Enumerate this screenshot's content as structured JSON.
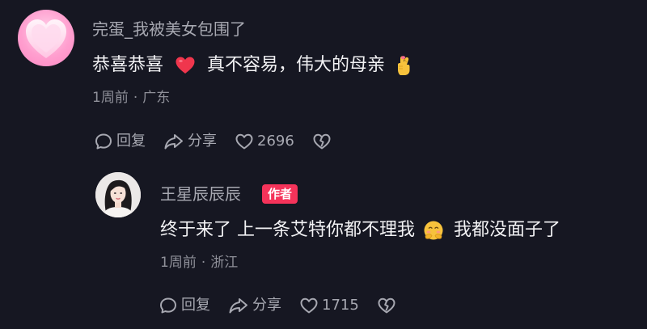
{
  "comment": {
    "username": "完蛋_我被美女包围了",
    "text_part1": "恭喜恭喜",
    "text_part2": "真不容易，伟大的母亲",
    "time": "1周前",
    "separator": "·",
    "location": "广东",
    "actions": {
      "reply_label": "回复",
      "share_label": "分享",
      "like_count": "2696"
    },
    "icons": {
      "avatar": "pink-heart-avatar",
      "emoji_1": "red-heart-emoji",
      "emoji_2": "crossed-fingers-hand-emoji"
    }
  },
  "reply": {
    "username": "王星辰辰辰",
    "badge": "作者",
    "text_part1": "终于来了 上一条艾特你都不理我",
    "text_part2": "我都没面子了",
    "time": "1周前",
    "separator": "·",
    "location": "浙江",
    "actions": {
      "reply_label": "回复",
      "share_label": "分享",
      "like_count": "1715"
    },
    "icons": {
      "avatar": "woman-portrait-avatar",
      "emoji_1": "shy-face-emoji"
    }
  },
  "colors": {
    "background": "#161722",
    "username": "#a7a8b1",
    "text": "#f2f2f4",
    "meta": "#8f9099",
    "author_badge": "#f5335a"
  }
}
